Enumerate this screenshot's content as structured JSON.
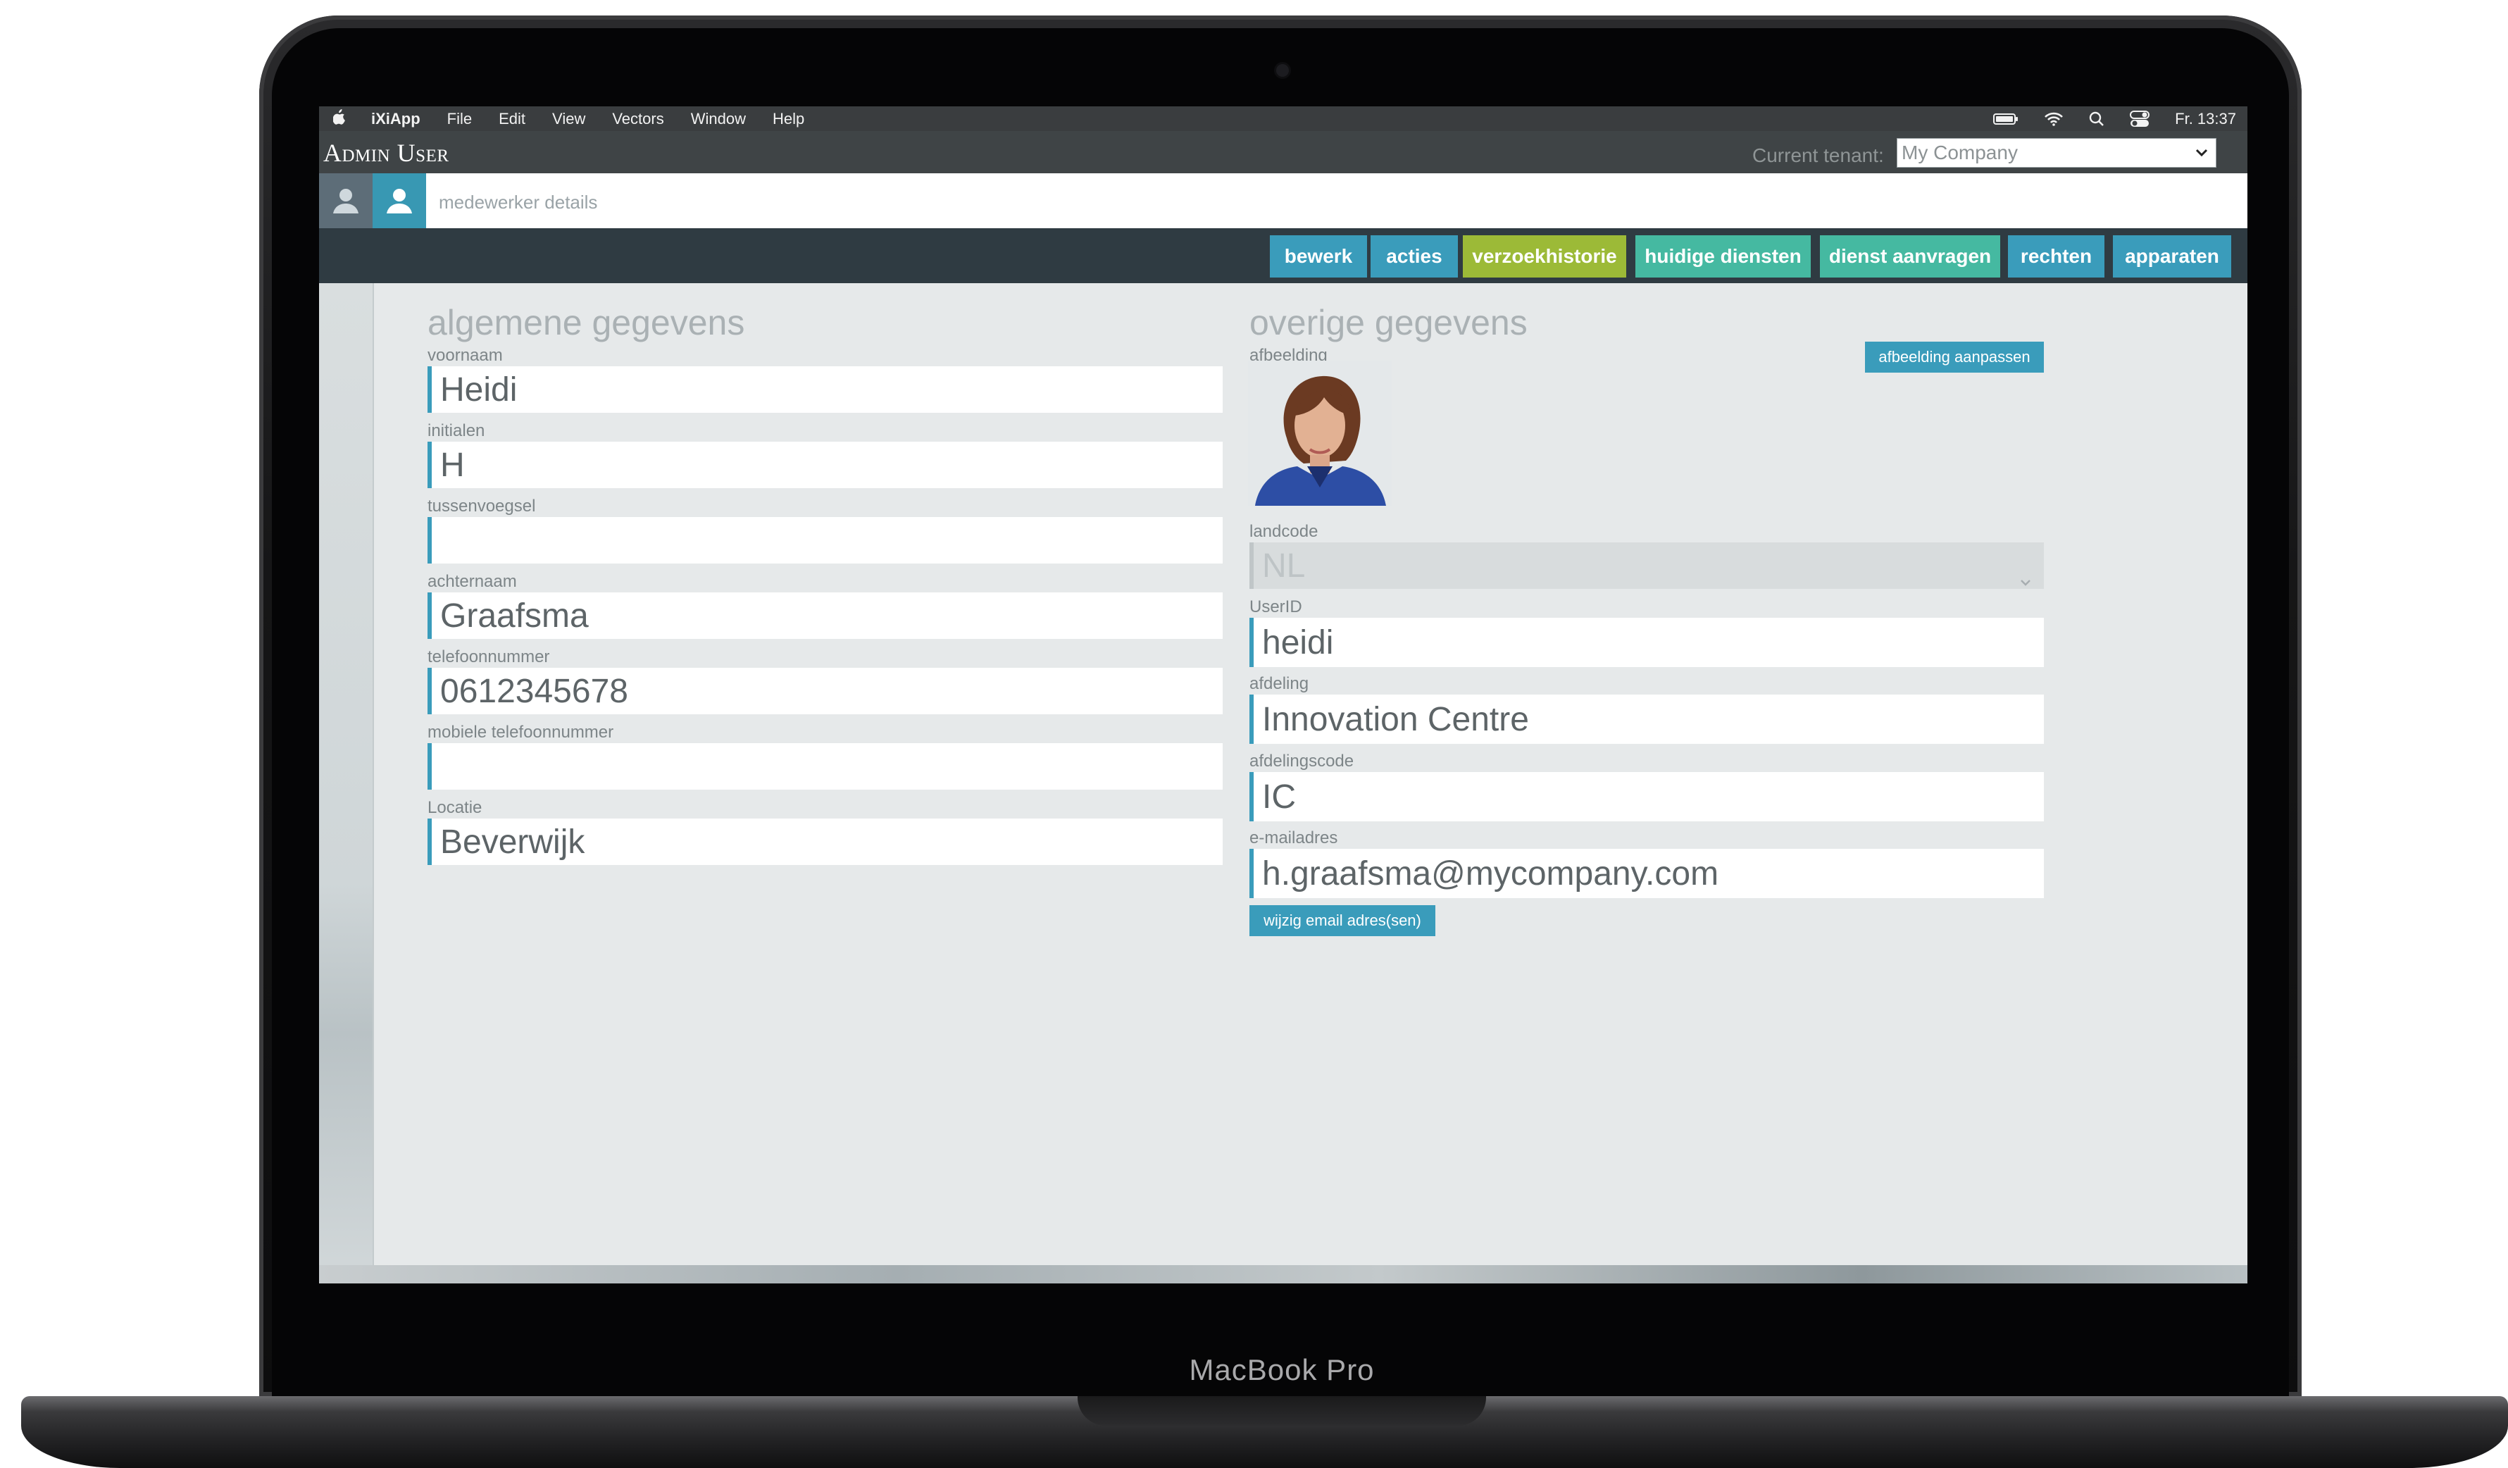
{
  "device": {
    "model_label": "MacBook Pro"
  },
  "menubar": {
    "apple": "",
    "items": [
      "iXiApp",
      "File",
      "Edit",
      "View",
      "Vectors",
      "Window",
      "Help"
    ],
    "clock": "Fr. 13:37"
  },
  "app": {
    "title": "Admin User",
    "tenant_label": "Current tenant:",
    "tenant_value": "My Company"
  },
  "breadcrumb": {
    "text": "medewerker details"
  },
  "toolbar": {
    "buttons": [
      {
        "label": "bewerk",
        "color": "#3a9cbb"
      },
      {
        "label": "acties",
        "color": "#3a9cbb"
      },
      {
        "label": "verzoekhistorie",
        "color": "#9cba37"
      },
      {
        "label": "huidige diensten",
        "color": "#45b9a1"
      },
      {
        "label": "dienst aanvragen",
        "color": "#45b9a1"
      },
      {
        "label": "rechten",
        "color": "#3a9cbb"
      },
      {
        "label": "apparaten",
        "color": "#3a9cbb"
      }
    ]
  },
  "general": {
    "title": "algemene gegevens",
    "fields": [
      {
        "label": "voornaam",
        "value": "Heidi"
      },
      {
        "label": "initialen",
        "value": "H"
      },
      {
        "label": "tussenvoegsel",
        "value": ""
      },
      {
        "label": "achternaam",
        "value": "Graafsma"
      },
      {
        "label": "telefoonnummer",
        "value": "0612345678"
      },
      {
        "label": "mobiele telefoonnummer",
        "value": ""
      },
      {
        "label": "Locatie",
        "value": "Beverwijk"
      }
    ]
  },
  "other": {
    "title": "overige gegevens",
    "image_label": "afbeelding",
    "image_button": "afbeelding aanpassen",
    "country_label": "landcode",
    "country_value": "NL",
    "fields": [
      {
        "label": "UserID",
        "value": "heidi"
      },
      {
        "label": "afdeling",
        "value": "Innovation Centre"
      },
      {
        "label": "afdelingscode",
        "value": "IC"
      },
      {
        "label": "e-mailadres",
        "value": "h.graafsma@mycompany.com"
      }
    ],
    "email_button": "wijzig email adres(sen)"
  },
  "colors": {
    "accent": "#3a9cbb",
    "green": "#9cba37",
    "teal": "#45b9a1",
    "toolbar_bg": "#2f3b42",
    "content_bg": "#e6e9ea"
  }
}
